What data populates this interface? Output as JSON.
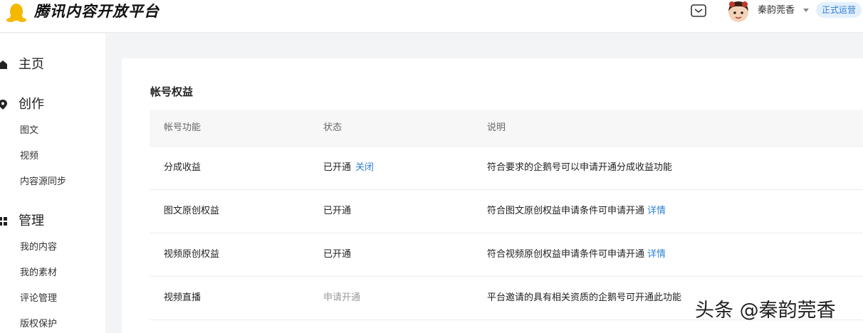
{
  "header": {
    "brand": "腾讯内容开放平台",
    "username": "秦韵莞香",
    "status_badge": "正式运营"
  },
  "sidebar": {
    "sections": [
      {
        "label": "主页",
        "icon": "home-icon"
      },
      {
        "label": "创作",
        "icon": "pin-icon",
        "items": [
          "图文",
          "视频",
          "内容源同步"
        ]
      },
      {
        "label": "管理",
        "icon": "grid-icon",
        "items": [
          "我的内容",
          "我的素材",
          "评论管理",
          "版权保护"
        ]
      }
    ]
  },
  "main": {
    "title": "帐号权益",
    "columns": [
      "帐号功能",
      "状态",
      "说明"
    ],
    "rows": [
      {
        "feature": "分成收益",
        "status": "已开通",
        "action": "关闭",
        "desc": "符合要求的企鹅号可以申请开通分成收益功能",
        "desc_link": ""
      },
      {
        "feature": "图文原创权益",
        "status": "已开通",
        "action": "",
        "desc": "符合图文原创权益申请条件可申请开通",
        "desc_link": "详情"
      },
      {
        "feature": "视频原创权益",
        "status": "已开通",
        "action": "",
        "desc": "符合视频原创权益申请条件可申请开通",
        "desc_link": "详情"
      },
      {
        "feature": "视频直播",
        "status": "申请开通",
        "action": "",
        "desc": "平台邀请的具有相关资质的企鹅号可开通此功能",
        "desc_link": ""
      }
    ]
  },
  "watermark": "头条 @秦韵莞香",
  "colors": {
    "accent": "#2e7fd1",
    "badge_bg": "#e3f0fc",
    "logo": "#f5b800"
  }
}
